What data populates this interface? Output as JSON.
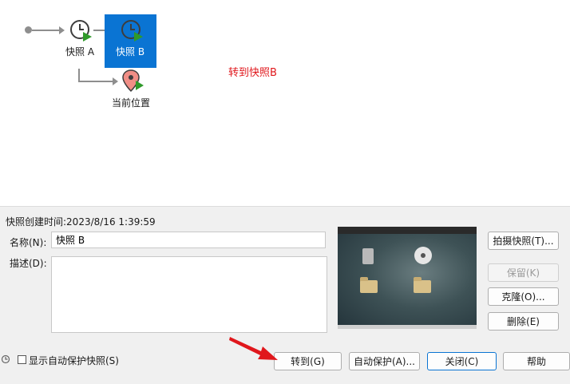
{
  "tree": {
    "snapshot_a_label": "快照 A",
    "snapshot_b_label": "快照 B",
    "current_state_label": "当前位置",
    "annotation": "转到快照B"
  },
  "details": {
    "created_label": "快照创建时间:2023/8/16 1:39:59",
    "name_label": "名称(N):",
    "name_value": "快照 B",
    "description_label": "描述(D):",
    "description_value": ""
  },
  "side_buttons": {
    "take_snapshot": "拍摄快照(T)...",
    "keep": "保留(K)",
    "clone": "克隆(O)...",
    "delete": "删除(E)"
  },
  "footer": {
    "show_autoprotect_label": "显示自动保护快照(S)",
    "show_autoprotect_checked": false,
    "goto": "转到(G)",
    "autoprotect": "自动保护(A)...",
    "close": "关闭(C)",
    "help": "帮助"
  },
  "colors": {
    "selection": "#0a74d3",
    "annotation": "#e0171c",
    "play_green": "#2f9a2a"
  }
}
